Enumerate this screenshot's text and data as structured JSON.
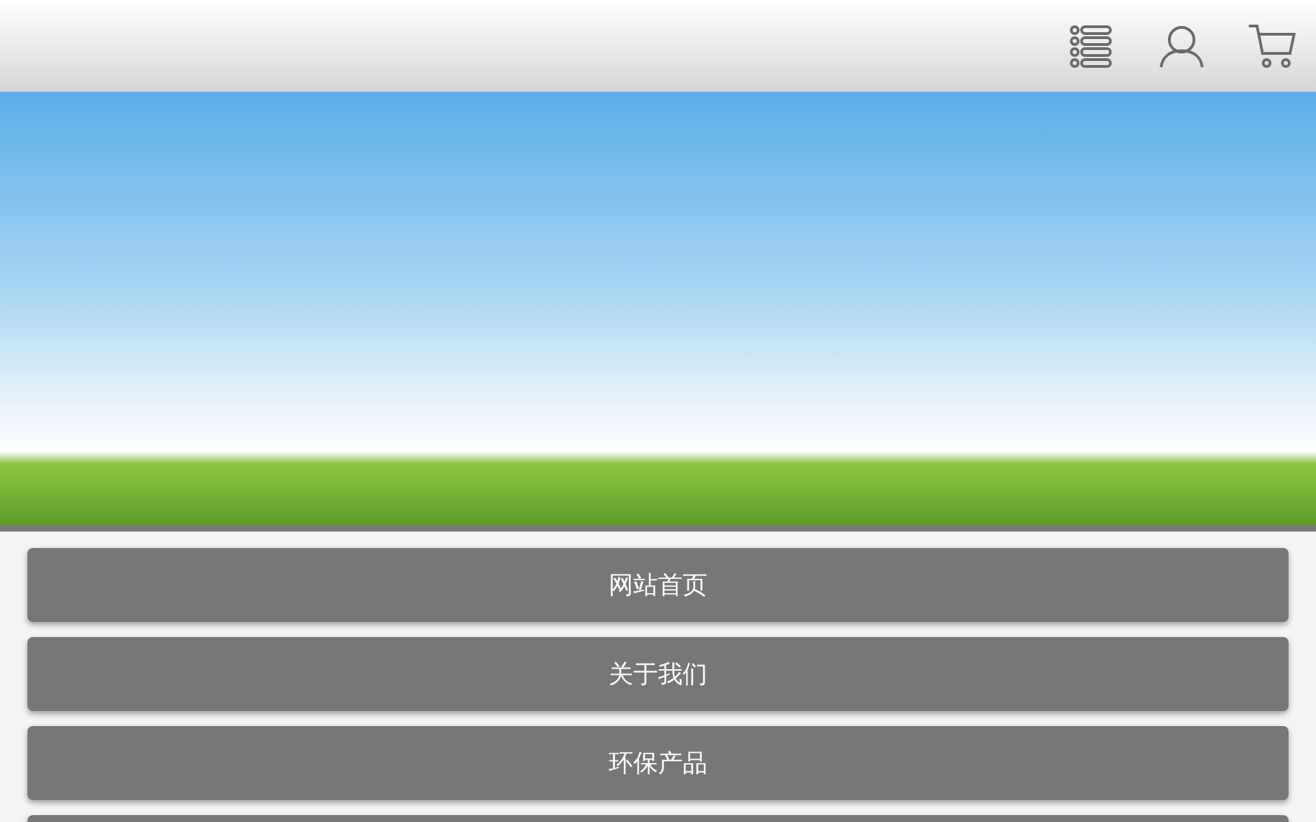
{
  "header": {
    "icons": [
      {
        "kind": "list"
      },
      {
        "kind": "user"
      },
      {
        "kind": "cart"
      }
    ]
  },
  "nav": {
    "items": [
      {
        "label": "网站首页"
      },
      {
        "label": "关于我们"
      },
      {
        "label": "环保产品"
      }
    ],
    "more_below": true
  }
}
